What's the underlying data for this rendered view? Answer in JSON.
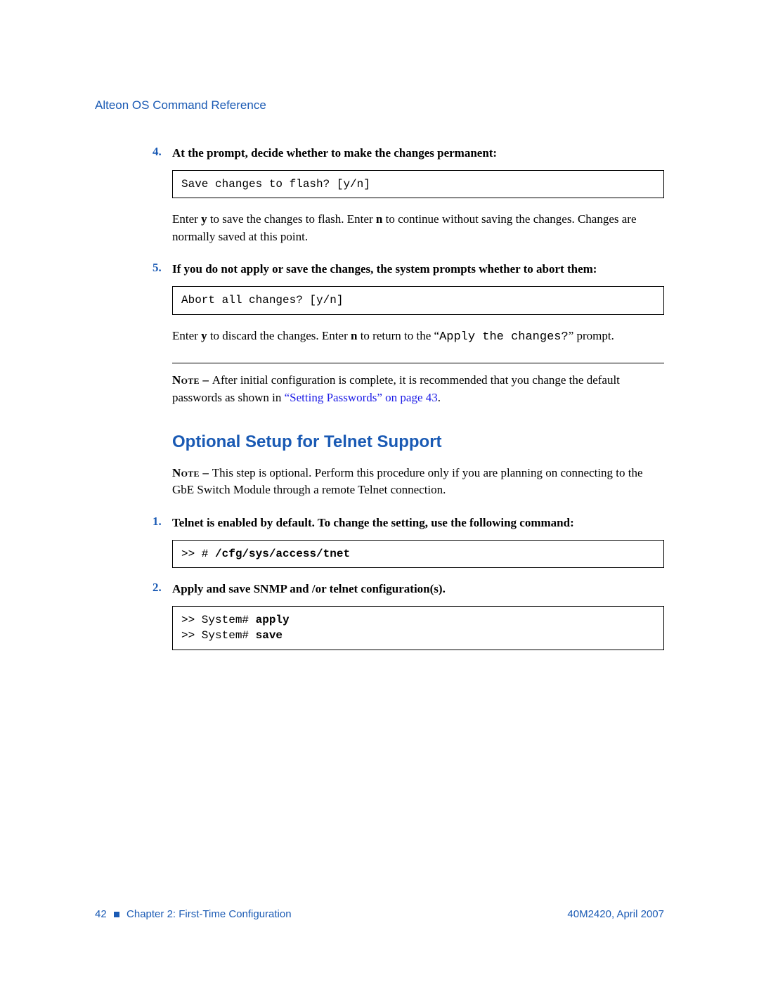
{
  "header": "Alteon OS Command Reference",
  "s4": {
    "n": "4.",
    "t": "At the prompt, decide whether to make the changes permanent:",
    "code": "Save changes to flash? [y/n]",
    "p_a": "Enter ",
    "p_b": "y",
    "p_c": " to save the changes to flash. Enter ",
    "p_d": "n",
    "p_e": " to continue without saving the changes. Changes are normally saved at this point."
  },
  "s5": {
    "n": "5.",
    "t": "If you do not apply or save the changes, the system prompts whether to abort them:",
    "code": "Abort all changes? [y/n]",
    "p_a": "Enter ",
    "p_b": "y",
    "p_c": " to discard the changes. Enter ",
    "p_d": "n",
    "p_e": " to return to the “",
    "p_f": "Apply the changes?",
    "p_g": "” prompt."
  },
  "note1": {
    "lbl": "Note – ",
    "a": "After initial configuration is complete, it is recommended that you change the default passwords as shown in ",
    "link": "“Setting Passwords” on page 43",
    "b": "."
  },
  "h2": "Optional Setup for Telnet Support",
  "note2": {
    "lbl": "Note – ",
    "a": "This step is optional. Perform this procedure only if you are planning on connecting to the GbE Switch Module through a remote Telnet connection."
  },
  "t1": {
    "n": "1.",
    "t": "Telnet is enabled by default. To change the setting, use the following command:",
    "code_a": ">> # ",
    "code_b": "/cfg/sys/access/tnet"
  },
  "t2": {
    "n": "2.",
    "t": "Apply and save SNMP and /or telnet configuration(s).",
    "c1a": ">> System# ",
    "c1b": "apply",
    "c2a": ">> System# ",
    "c2b": "save"
  },
  "footer": {
    "pg": "42",
    "chap": "Chapter 2:  First-Time Configuration",
    "right": "40M2420, April 2007"
  }
}
